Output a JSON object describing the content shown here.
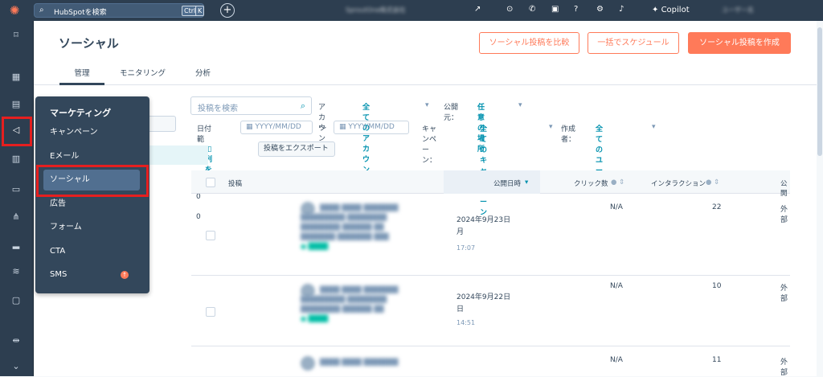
{
  "topbar": {
    "search_placeholder": "HubSpotを検索",
    "kbd_ctrl": "Ctrl",
    "kbd_k": "K",
    "account_blur": "SproutOne株式会社",
    "copilot": "Copilot",
    "user_blur": "ユーザー名"
  },
  "page": {
    "title": "ソーシャル",
    "btn_compare": "ソーシャル投稿を比較",
    "btn_schedule": "一括でスケジュール",
    "btn_create": "ソーシャル投稿を作成"
  },
  "tabs": [
    "管理",
    "モニタリング",
    "分析"
  ],
  "filters": {
    "search_placeholder": "投稿を検索",
    "account_label": "アカウント:",
    "account_value": "全てのアカウント",
    "publish_label": "公開元：",
    "publish_value": "任意の場所",
    "date_label": "日付範囲：",
    "date_from": "YYYY/MM/DD",
    "date_sep": "〜",
    "date_to": "YYYY/MM/DD",
    "campaign_label": "キャンペーン：",
    "campaign_value": "全てのキャンペーン",
    "author_label": "作成者：",
    "author_value": "全てのユーザー",
    "manage_columns": "列を管理",
    "export": "投稿をエクスポート"
  },
  "table": {
    "headers": [
      "投稿",
      "公開日時",
      "クリック数",
      "インタラクション",
      "公開"
    ],
    "rows": [
      {
        "date1": "2024年9月23日",
        "date2": "月",
        "time": "17:07",
        "clicks": "N/A",
        "interactions": "22",
        "source": "外部"
      },
      {
        "date1": "2024年9月22日",
        "date2": "日",
        "time": "14:51",
        "clicks": "N/A",
        "interactions": "10",
        "source": "外部"
      },
      {
        "date1": "",
        "date2": "",
        "time": "",
        "clicks": "N/A",
        "interactions": "11",
        "source": "外部"
      }
    ]
  },
  "side_counts": [
    "0",
    "0",
    "0"
  ],
  "menu": {
    "heading": "マーケティング",
    "items": [
      "キャンペーン",
      "Eメール",
      "ソーシャル",
      "広告",
      "フォーム",
      "CTA",
      "SMS"
    ]
  },
  "colors": {
    "accent": "#ff7a59",
    "nav": "#2d3e50",
    "highlight": "#e61f1f",
    "link": "#0091ae"
  }
}
